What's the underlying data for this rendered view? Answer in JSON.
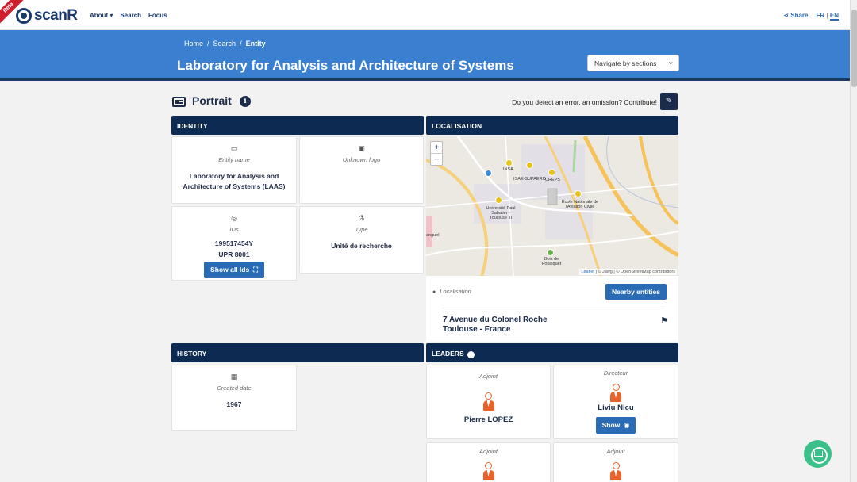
{
  "nav": {
    "beta": "Beta",
    "logo": "scanR",
    "links": [
      "About ▾",
      "Search",
      "Focus"
    ],
    "share": "Share",
    "lang_fr": "FR",
    "lang_sep": "|",
    "lang_en": "EN"
  },
  "header": {
    "breadcrumb": [
      "Home",
      "/",
      "Search",
      "/",
      "Entity"
    ],
    "title": "Laboratory for Analysis and Architecture of Systems",
    "navigate_select": "Navigate by sections"
  },
  "portrait": {
    "title": "Portrait",
    "contribute": "Do you detect an error, an omission? Contribute!"
  },
  "identity": {
    "header": "IDENTITY",
    "entity_name_label": "Entity name",
    "entity_name": "Laboratory for Analysis and Architecture of Systems (LAAS)",
    "logo_label": "Unknown logo",
    "ids_label": "IDs",
    "id_1": "199517454Y",
    "id_2": "UPR 8001",
    "show_ids": "Show all Ids",
    "type_label": "Type",
    "type_value": "Unité de recherche"
  },
  "localisation": {
    "header": "LOCALISATION",
    "map_labels": [
      "INSA",
      "ISAE-SUPAERO",
      "CREPS",
      "Université Paul Sabatier - Toulouse III",
      "École Nationale de l'Aviation Civile",
      "Bois de Pouciquet",
      "anguel"
    ],
    "credit_leaflet": "Leaflet",
    "credit_rest": " | © Jawg | © OpenStreetMap contributors",
    "zoom_in": "+",
    "zoom_out": "−",
    "label": "Localisation",
    "nearby": "Nearby entities",
    "address_line1": "7 Avenue du Colonel Roche",
    "address_line2": "Toulouse - France"
  },
  "history": {
    "header": "HISTORY",
    "created_label": "Created date",
    "created_value": "1967"
  },
  "leaders": {
    "header": "LEADERS",
    "items": [
      {
        "role": "Adjoint",
        "name": "Pierre LOPEZ"
      },
      {
        "role": "Directeur",
        "name": "Liviu Nicu",
        "show": "Show"
      },
      {
        "role": "Adjoint",
        "name": ""
      },
      {
        "role": "Adjoint",
        "name": ""
      }
    ]
  },
  "colors": {
    "brand": "#3a7fd0",
    "dark": "#0d2b52",
    "accent": "#e8632b",
    "chat": "#3cc08a"
  }
}
